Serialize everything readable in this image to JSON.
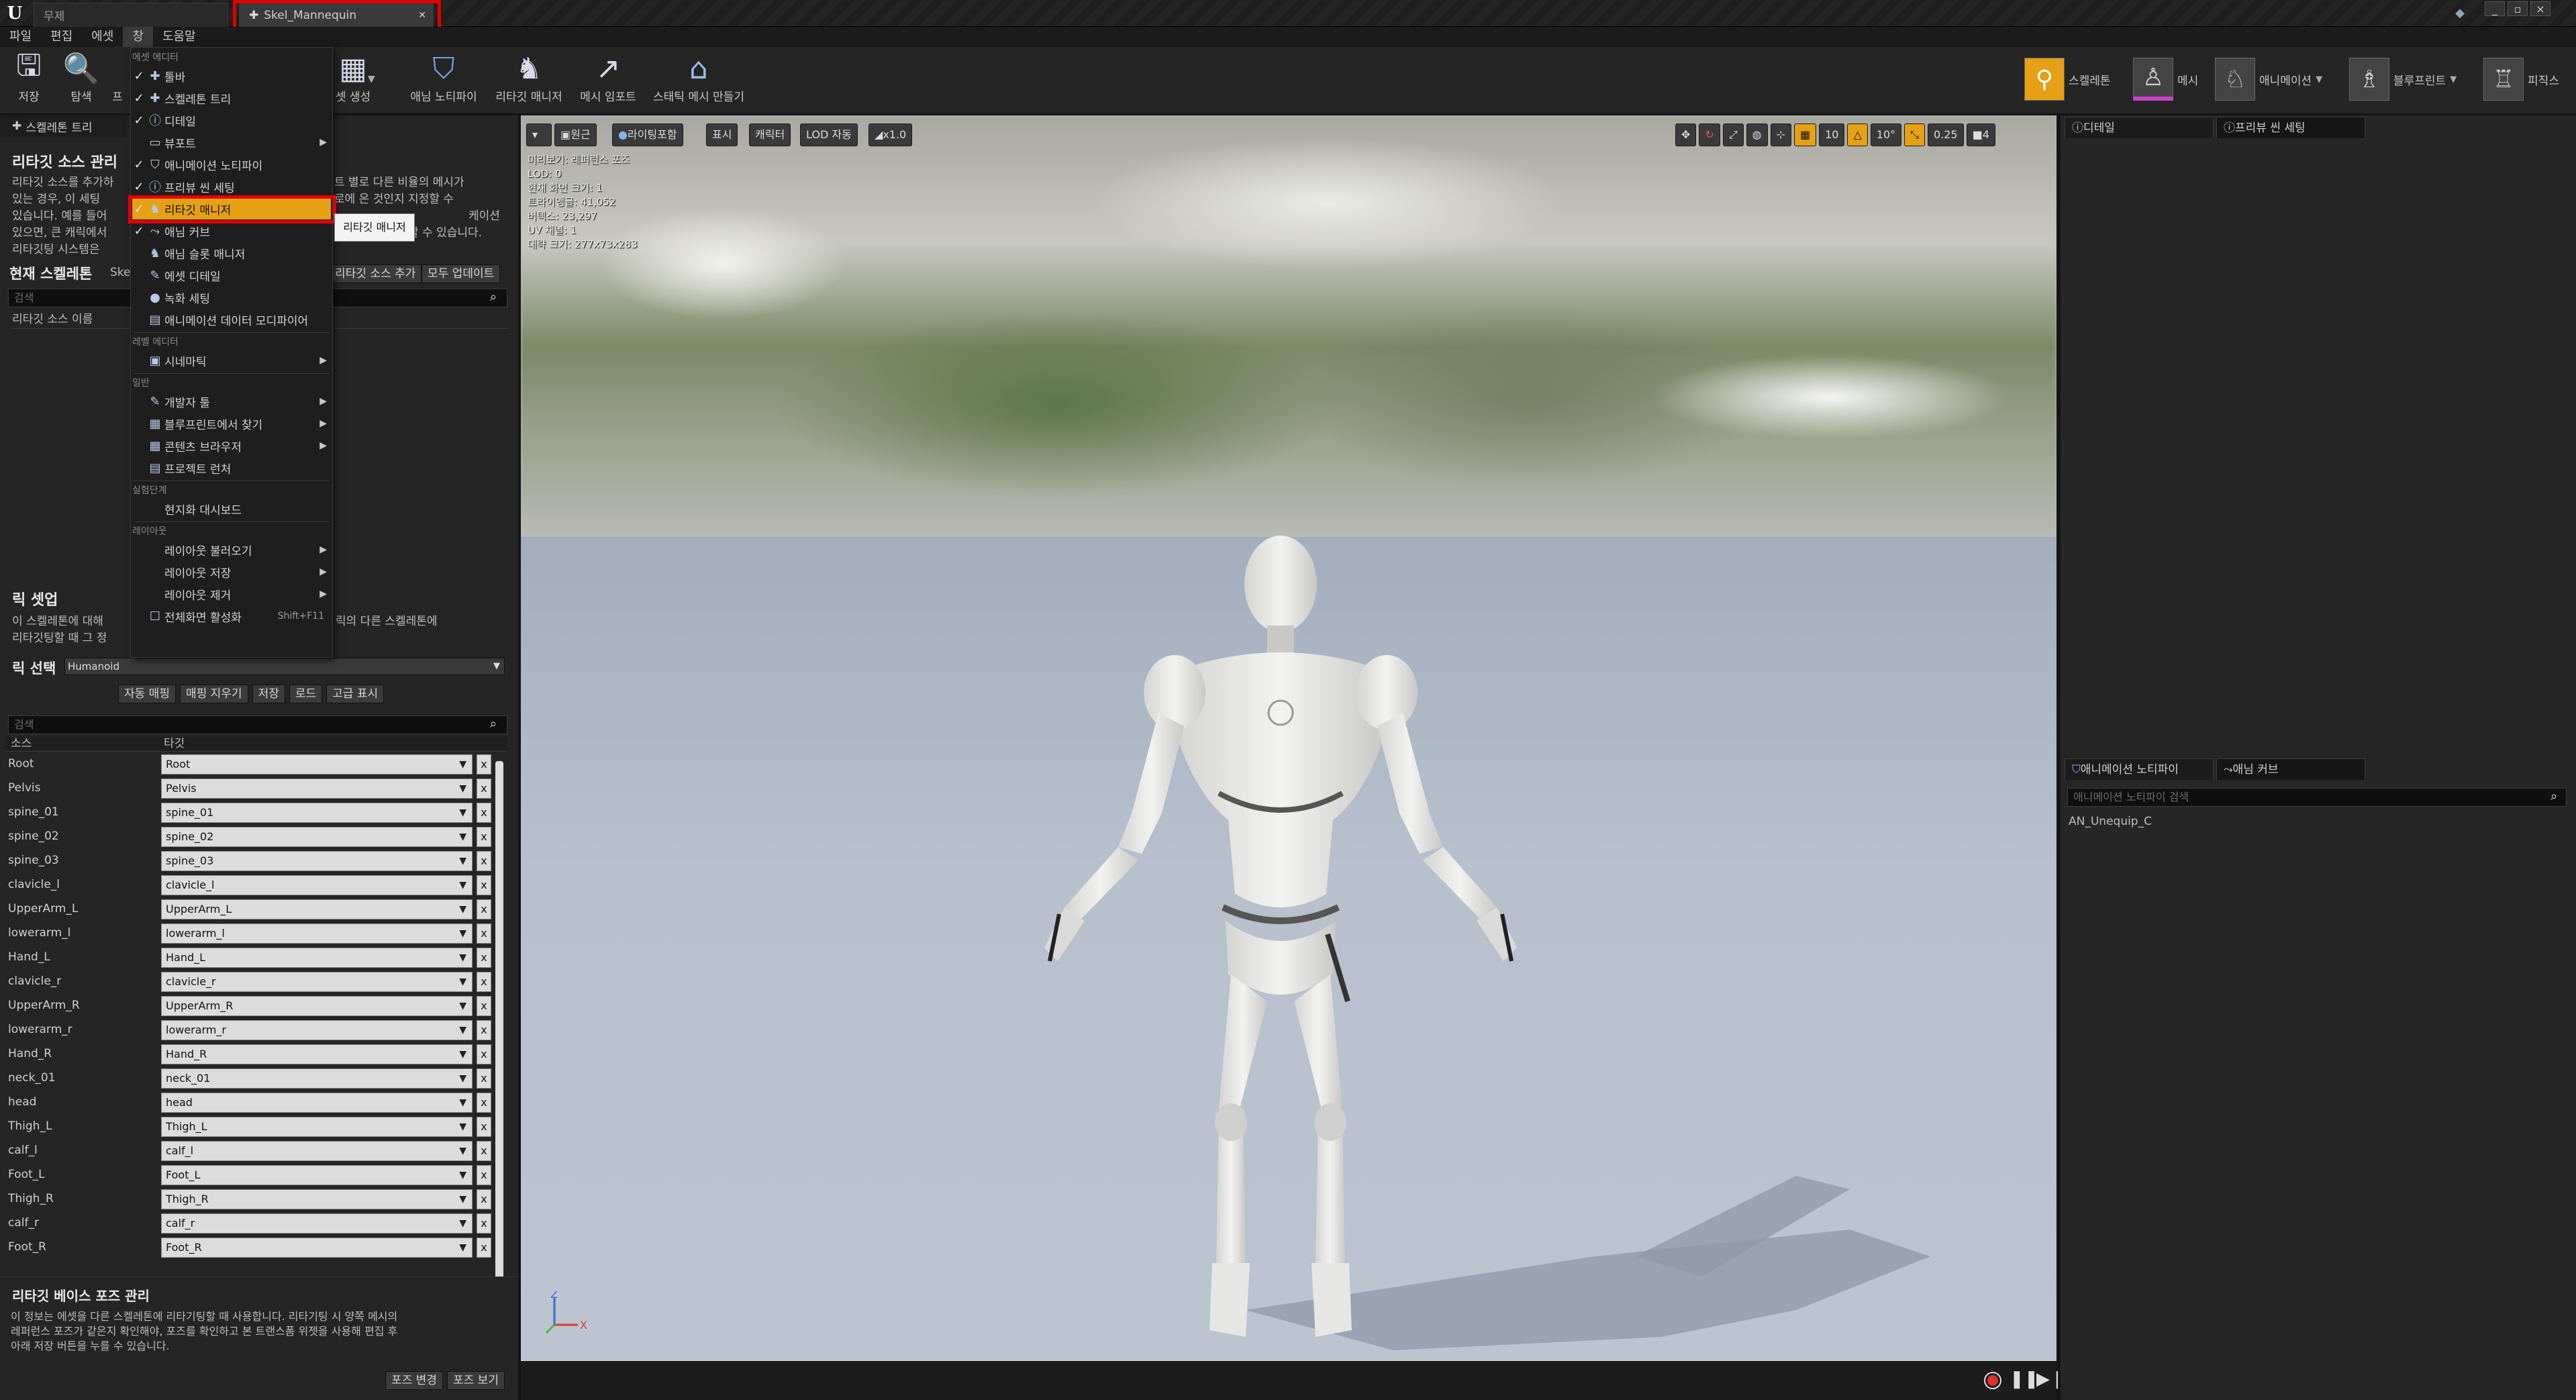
{
  "window": {
    "tabs": [
      "무제",
      "Skel_Mannequin"
    ],
    "controls": [
      "_",
      "▫",
      "×"
    ]
  },
  "menubar": [
    "파일",
    "편집",
    "에셋",
    "창",
    "도움말"
  ],
  "toolbar": {
    "buttons": [
      {
        "label": "저장",
        "icon": "save-icon"
      },
      {
        "label": "탐색",
        "icon": "browse-icon"
      },
      {
        "label": "프",
        "icon": "preview-icon"
      },
      {
        "label": "셋 생성",
        "icon": "make-asset-icon"
      },
      {
        "label": "애님 노티파이",
        "icon": "anim-notify-icon"
      },
      {
        "label": "리타깃 매니저",
        "icon": "retarget-manager-icon"
      },
      {
        "label": "메시 임포트",
        "icon": "mesh-import-icon"
      },
      {
        "label": "스태틱 메시 만들기",
        "icon": "make-static-mesh-icon"
      }
    ],
    "modes": [
      {
        "label": "스켈레톤",
        "active": true
      },
      {
        "label": "메시",
        "active": false
      },
      {
        "label": "애니메이션",
        "active": false
      },
      {
        "label": "블루프린트",
        "active": false
      },
      {
        "label": "피직스",
        "active": false
      }
    ]
  },
  "left_panel": {
    "tab": "스켈레톤 트리",
    "retarget_source": {
      "title": "리타깃 소스 관리",
      "desc": [
        "리타깃 소스를 추가하",
        "있는 경우, 이 세팅",
        "있습니다. 예를 들어",
        "있으면, 큰 캐릭에서",
        "리타깃팅 시스템은"
      ],
      "desc_right": [
        "트 별로 다른 비율의 메시가",
        "로에 온 것인지 지정할 수",
        "케이션",
        "할 수 있습니다."
      ],
      "current_skeleton_label": "현재 스켈레톤",
      "current_skeleton_value": "Ske",
      "add_button": "리타깃 소스 추가",
      "update_all_button": "모두 업데이트",
      "search_placeholder": "검색",
      "column": "리타깃 소스 이름"
    },
    "rig_setup": {
      "title": "릭 셋업",
      "desc": [
        "이 스켈레톤에 대해",
        "리타깃팅할 때 그 정"
      ],
      "desc_right": [
        "릭의 다른 스켈레톤에"
      ],
      "rig_select_label": "릭 선택",
      "rig_select_value": "Humanoid",
      "buttons": [
        "자동 매핑",
        "매핑 지우기",
        "저장",
        "로드",
        "고급 표시"
      ],
      "search_placeholder": "검색",
      "col_source": "소스",
      "col_target": "타깃",
      "rows": [
        {
          "src": "Root",
          "tgt": "Root"
        },
        {
          "src": "Pelvis",
          "tgt": "Pelvis"
        },
        {
          "src": "spine_01",
          "tgt": "spine_01"
        },
        {
          "src": "spine_02",
          "tgt": "spine_02"
        },
        {
          "src": "spine_03",
          "tgt": "spine_03"
        },
        {
          "src": "clavicle_l",
          "tgt": "clavicle_l"
        },
        {
          "src": "UpperArm_L",
          "tgt": "UpperArm_L"
        },
        {
          "src": "lowerarm_l",
          "tgt": "lowerarm_l"
        },
        {
          "src": "Hand_L",
          "tgt": "Hand_L"
        },
        {
          "src": "clavicle_r",
          "tgt": "clavicle_r"
        },
        {
          "src": "UpperArm_R",
          "tgt": "UpperArm_R"
        },
        {
          "src": "lowerarm_r",
          "tgt": "lowerarm_r"
        },
        {
          "src": "Hand_R",
          "tgt": "Hand_R"
        },
        {
          "src": "neck_01",
          "tgt": "neck_01"
        },
        {
          "src": "head",
          "tgt": "head"
        },
        {
          "src": "Thigh_L",
          "tgt": "Thigh_L"
        },
        {
          "src": "calf_l",
          "tgt": "calf_l"
        },
        {
          "src": "Foot_L",
          "tgt": "Foot_L"
        },
        {
          "src": "Thigh_R",
          "tgt": "Thigh_R"
        },
        {
          "src": "calf_r",
          "tgt": "calf_r"
        },
        {
          "src": "Foot_R",
          "tgt": "Foot_R"
        }
      ],
      "row_clear": "x"
    },
    "base_pose": {
      "title": "리타깃 베이스 포즈 관리",
      "desc": [
        "이 정보는 에셋을 다른 스켈레톤에 리타기팅할 때 사용합니다. 리타기팅 시 양쪽 메시의",
        "레퍼런스 포즈가 같은지 확인해야, 포즈를 확인하고 본 트랜스폼 위젯을 사용해 편집 후",
        "아래 저장 버튼을 누를 수 있습니다."
      ],
      "buttons": [
        "포즈 변경",
        "포즈 보기"
      ]
    }
  },
  "window_menu": {
    "sections": [
      {
        "header": "에셋 에디터",
        "items": [
          {
            "label": "툴바",
            "checked": true,
            "icon": "toolbar-icon"
          },
          {
            "label": "스켈레톤 트리",
            "checked": true,
            "icon": "skeleton-tree-icon"
          },
          {
            "label": "디테일",
            "checked": true,
            "icon": "details-icon"
          },
          {
            "label": "뷰포트",
            "checked": false,
            "icon": "viewport-icon",
            "submenu": true
          },
          {
            "label": "애니메이션 노티파이",
            "checked": true,
            "icon": "anim-notify-icon"
          },
          {
            "label": "프리뷰 씬 세팅",
            "checked": true,
            "icon": "preview-scene-icon"
          },
          {
            "label": "리타깃 매니저",
            "checked": true,
            "icon": "retarget-manager-icon",
            "highlighted": true
          },
          {
            "label": "애님 커브",
            "checked": true,
            "icon": "anim-curve-icon"
          },
          {
            "label": "애님 슬롯 매니저",
            "checked": false,
            "icon": "slot-manager-icon"
          },
          {
            "label": "에셋 디테일",
            "checked": false,
            "icon": "asset-details-icon"
          },
          {
            "label": "녹화 세팅",
            "checked": false,
            "icon": "record-icon"
          },
          {
            "label": "애니메이션 데이터 모디파이어",
            "checked": false,
            "icon": "data-modifier-icon"
          }
        ]
      },
      {
        "header": "레벨 에디터",
        "items": [
          {
            "label": "시네마틱",
            "checked": false,
            "icon": "cinematic-icon",
            "submenu": true
          }
        ]
      },
      {
        "header": "일반",
        "items": [
          {
            "label": "개발자 툴",
            "checked": false,
            "icon": "dev-tools-icon",
            "submenu": true
          },
          {
            "label": "블루프린트에서 찾기",
            "checked": false,
            "icon": "find-bp-icon",
            "submenu": true
          },
          {
            "label": "콘텐츠 브라우저",
            "checked": false,
            "icon": "content-browser-icon",
            "submenu": true
          },
          {
            "label": "프로젝트 런처",
            "checked": false,
            "icon": "project-launcher-icon"
          }
        ]
      },
      {
        "header": "실험단계",
        "items": [
          {
            "label": "현지화 대시보드",
            "checked": false,
            "icon": ""
          }
        ]
      },
      {
        "header": "레이아웃",
        "items": [
          {
            "label": "레이아웃 불러오기",
            "checked": false,
            "icon": "",
            "submenu": true
          },
          {
            "label": "레이아웃 저장",
            "checked": false,
            "icon": "",
            "submenu": true
          },
          {
            "label": "레이아웃 제거",
            "checked": false,
            "icon": "",
            "submenu": true
          },
          {
            "label": "전체화면 활성화",
            "checked": false,
            "icon": "checkbox-icon",
            "shortcut": "Shift+F11"
          }
        ]
      }
    ],
    "tooltip": "리타깃 매니저"
  },
  "viewport": {
    "toolbar": [
      "원근",
      "라이팅포함",
      "표시",
      "캐릭터",
      "LOD 자동",
      "x1.0"
    ],
    "right_tools": {
      "grid_snap": "10",
      "rot_snap": "10°",
      "scale_snap": "0.25",
      "cam_speed": "4"
    },
    "stats": [
      "미리보기: 레퍼런스 포즈",
      "LOD: 0",
      "현재 화면 크기: 1",
      "트라이앵글: 41,052",
      "버텍스: 23,297",
      "UV 채널: 1",
      "대략 크기: 277x73x283"
    ],
    "axis": {
      "z": "Z",
      "x": "X"
    }
  },
  "right_panel": {
    "tabs_top": [
      "디테일",
      "프리뷰 씬 세팅"
    ],
    "tabs_bottom": [
      "애니메이션 노티파이",
      "애님 커브"
    ],
    "notify_search_placeholder": "애니메이션 노티파이 검색",
    "notify_items": [
      "AN_Unequip_C"
    ]
  },
  "colors": {
    "highlight": "#e6a014",
    "redbox": "#e00000",
    "accent_mode": "#e6a014"
  }
}
